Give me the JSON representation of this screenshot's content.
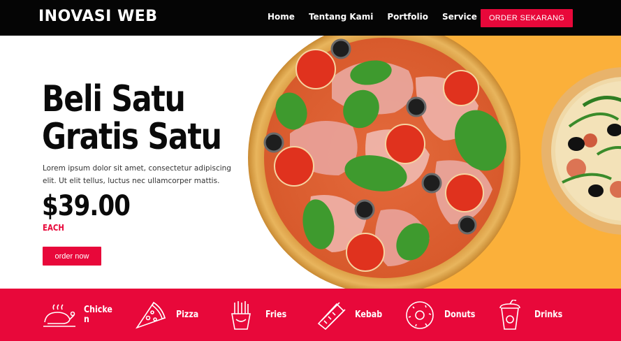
{
  "header": {
    "brand": "INOVASI WEB",
    "nav": [
      "Home",
      "Tentang Kami",
      "Portfolio",
      "Service"
    ],
    "order_button": "ORDER SEKARANG"
  },
  "hero": {
    "headline_line1": "Beli Satu",
    "headline_line2": "Gratis Satu",
    "description": "Lorem ipsum dolor sit amet, consectetur adipiscing elit. Ut elit tellus, luctus nec ullamcorper mattis.",
    "price": "$39.00",
    "price_unit": "EACH",
    "cta": "order now"
  },
  "categories": [
    {
      "label": "Chicke\nn",
      "icon": "chicken-icon"
    },
    {
      "label": "Pizza",
      "icon": "pizza-icon"
    },
    {
      "label": "Fries",
      "icon": "fries-icon"
    },
    {
      "label": "Kebab",
      "icon": "kebab-icon"
    },
    {
      "label": "Donuts",
      "icon": "donut-icon"
    },
    {
      "label": "Drinks",
      "icon": "drink-icon"
    }
  ],
  "colors": {
    "accent": "#e8083a",
    "header_bg": "#050505",
    "hero_panel": "#fbb03a"
  }
}
